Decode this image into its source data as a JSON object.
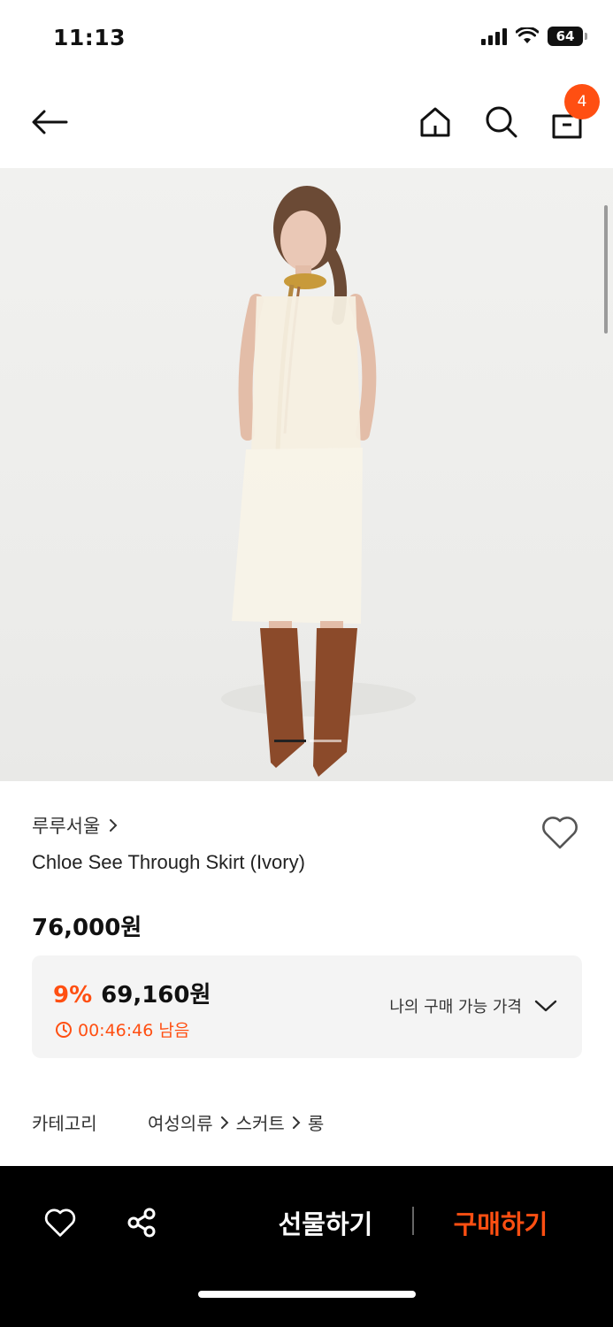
{
  "status_bar": {
    "time": "11:13",
    "battery": "64"
  },
  "header": {
    "cart_count": "4"
  },
  "gallery": {
    "page_count": 2,
    "active_page": 1
  },
  "product": {
    "brand": "루루서울",
    "name": "Chloe See Through Skirt (Ivory)",
    "price": "76,000원",
    "discount": {
      "rate": "9%",
      "price": "69,160원",
      "timer": "00:46:46 남음",
      "my_price_label": "나의 구매 가능 가격"
    },
    "category": {
      "label": "카테고리",
      "path": [
        "여성의류",
        "스커트",
        "롱"
      ]
    }
  },
  "bottom_bar": {
    "gift_label": "선물하기",
    "buy_label": "구매하기"
  },
  "colors": {
    "accent": "#ff4f12",
    "bottom_bar": "#000000"
  },
  "icons": [
    "back-arrow-icon",
    "home-icon",
    "search-icon",
    "shopping-bag-icon",
    "heart-icon",
    "share-icon",
    "clock-icon",
    "chevron-down-icon"
  ]
}
